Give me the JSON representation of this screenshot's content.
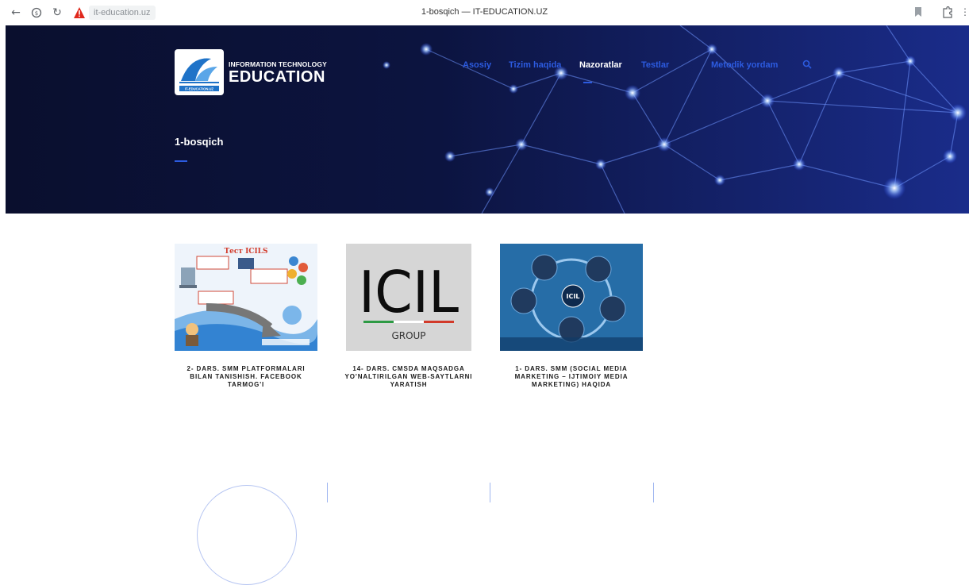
{
  "browser": {
    "url": "it-education.uz",
    "tab_title": "1-bosqich — IT-EDUCATION.UZ"
  },
  "logo": {
    "top_line": "INFORMATION TECHNOLOGY",
    "main_line": "EDUCATION",
    "mark_text": "IT-EDUCATION.UZ"
  },
  "menu": {
    "items": [
      {
        "label": "Asosiy"
      },
      {
        "label": "Tizim haqida"
      },
      {
        "label": "Nazoratlar"
      },
      {
        "label": "Testlar"
      },
      {
        "label": "Metodik yordam"
      }
    ],
    "active_index": 2
  },
  "hero": {
    "heading": "1-bosqich"
  },
  "cards": [
    {
      "title": "2- DARS. SMM PLATFORMALARI BILAN TANISHISH. FACEBOOK TARMOG'I",
      "image_caption": "Тест ICILS"
    },
    {
      "title": "14- DARS. CMSDA MAQSADGA YO'NALTIRILGAN WEB-SAYTLARNI YARATISH",
      "image_caption": "ICIL",
      "image_subcaption": "GROUP"
    },
    {
      "title": "1- DARS. SMM (SOCIAL MEDIA MARKETING – IJTIMOIY MEDIA MARKETING) HAQIDA",
      "image_caption": "ICIL"
    }
  ],
  "colors": {
    "accent": "#2c5be0",
    "hero_bg": "#0b1237",
    "text_dark": "#1b1b1b"
  },
  "icons": [
    "back-arrow-icon",
    "shield-icon",
    "reload-icon",
    "warning-icon",
    "bookmark-icon",
    "extension-icon",
    "more-icon",
    "search-icon"
  ]
}
